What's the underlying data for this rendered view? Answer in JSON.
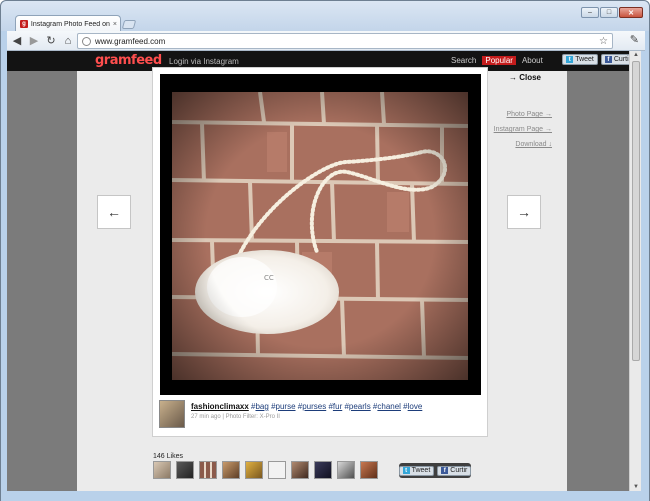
{
  "browser": {
    "tab_title": "Instagram Photo Feed on t",
    "tab_favicon": "g",
    "tab_close": "×",
    "url": "www.gramfeed.com",
    "window_buttons": [
      "–",
      "□",
      "✕"
    ]
  },
  "site": {
    "logo": "gramfeed",
    "login": "Login via Instagram",
    "nav": [
      "Search",
      "Popular",
      "About"
    ],
    "share": {
      "tweet": "Tweet",
      "curtir": "Curtir"
    }
  },
  "modal": {
    "close": "→ Close",
    "prev_arrow": "←",
    "next_arrow": "→",
    "side_links": [
      "Photo Page →",
      "Instagram Page →",
      "Download ↓"
    ],
    "username": "fashionclimaxx",
    "tags": [
      "bag",
      "purse",
      "purses",
      "fur",
      "pearls",
      "chanel",
      "love"
    ],
    "meta": "27 min ago | Photo Filter: X-Pro II",
    "likes_label": "146 Likes",
    "bottom_share": {
      "tweet": "Tweet",
      "curtir": "Curtir"
    }
  },
  "colors": {
    "accent": "#c41c1c",
    "logo": "#ff4e4e",
    "facebook": "#3b5998",
    "twitter": "#33a6d8"
  }
}
